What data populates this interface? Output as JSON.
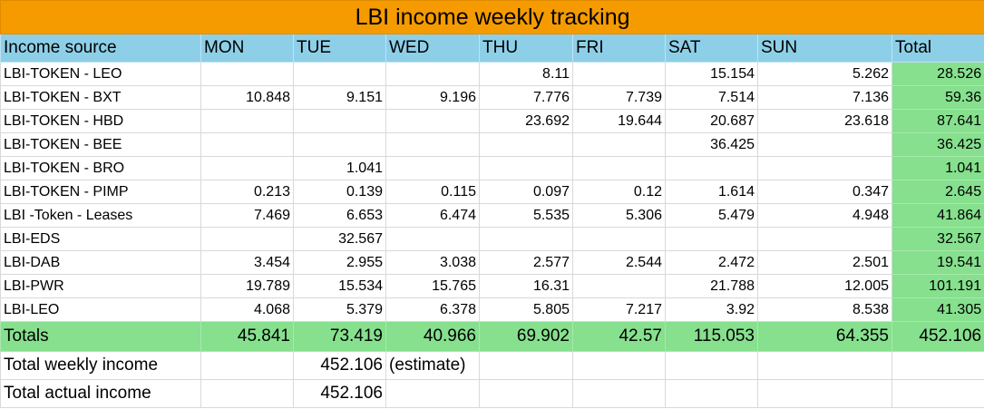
{
  "title": "LBI income weekly tracking",
  "headers": [
    "Income source",
    "MON",
    "TUE",
    "WED",
    "THU",
    "FRI",
    "SAT",
    "SUN",
    "Total"
  ],
  "rows": [
    {
      "source": "LBI-TOKEN - LEO",
      "values": [
        "",
        "",
        "",
        "8.11",
        "",
        "15.154",
        "5.262"
      ],
      "total": "28.526"
    },
    {
      "source": "LBI-TOKEN - BXT",
      "values": [
        "10.848",
        "9.151",
        "9.196",
        "7.776",
        "7.739",
        "7.514",
        "7.136"
      ],
      "total": "59.36"
    },
    {
      "source": "LBI-TOKEN - HBD",
      "values": [
        "",
        "",
        "",
        "23.692",
        "19.644",
        "20.687",
        "23.618"
      ],
      "total": "87.641"
    },
    {
      "source": "LBI-TOKEN - BEE",
      "values": [
        "",
        "",
        "",
        "",
        "",
        "36.425",
        ""
      ],
      "total": "36.425"
    },
    {
      "source": "LBI-TOKEN - BRO",
      "values": [
        "",
        "1.041",
        "",
        "",
        "",
        "",
        ""
      ],
      "total": "1.041"
    },
    {
      "source": "LBI-TOKEN - PIMP",
      "values": [
        "0.213",
        "0.139",
        "0.115",
        "0.097",
        "0.12",
        "1.614",
        "0.347"
      ],
      "total": "2.645"
    },
    {
      "source": "LBI -Token - Leases",
      "values": [
        "7.469",
        "6.653",
        "6.474",
        "5.535",
        "5.306",
        "5.479",
        "4.948"
      ],
      "total": "41.864"
    },
    {
      "source": "LBI-EDS",
      "values": [
        "",
        "32.567",
        "",
        "",
        "",
        "",
        ""
      ],
      "total": "32.567"
    },
    {
      "source": "LBI-DAB",
      "values": [
        "3.454",
        "2.955",
        "3.038",
        "2.577",
        "2.544",
        "2.472",
        "2.501"
      ],
      "total": "19.541"
    },
    {
      "source": "LBI-PWR",
      "values": [
        "19.789",
        "15.534",
        "15.765",
        "16.31",
        "",
        "21.788",
        "12.005"
      ],
      "total": "101.191"
    },
    {
      "source": "LBI-LEO",
      "values": [
        "4.068",
        "5.379",
        "6.378",
        "5.805",
        "7.217",
        "3.92",
        "8.538"
      ],
      "total": "41.305"
    }
  ],
  "totals": {
    "label": "Totals",
    "values": [
      "45.841",
      "73.419",
      "40.966",
      "69.902",
      "42.57",
      "115.053",
      "64.355"
    ],
    "total": "452.106"
  },
  "summary": {
    "weekly": {
      "label": "Total weekly income",
      "value": "452.106",
      "note": "(estimate)"
    },
    "actual": {
      "label": "Total actual income",
      "value": "452.106"
    }
  }
}
